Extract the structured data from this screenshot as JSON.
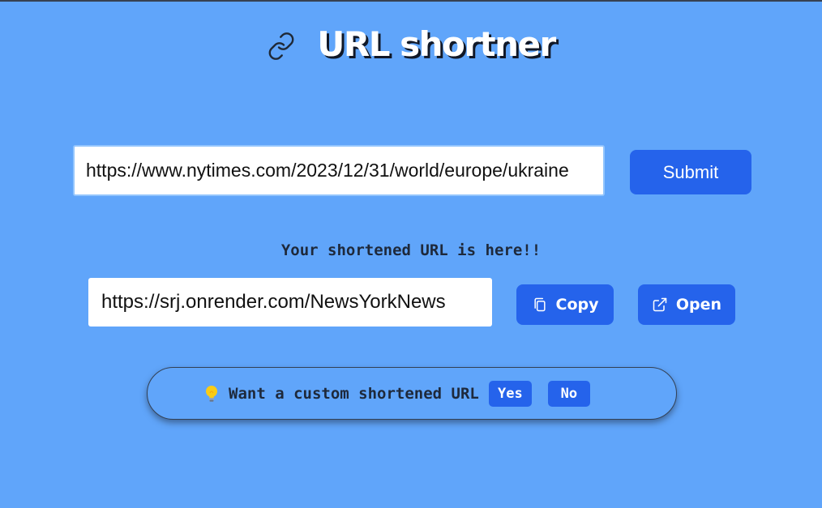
{
  "header": {
    "icon": "link-icon",
    "title": "URL shortner"
  },
  "form": {
    "url_value": "https://www.nytimes.com/2023/12/31/world/europe/ukraine",
    "submit_label": "Submit"
  },
  "result": {
    "label": "Your shortened URL is here!!",
    "short_url": "https://srj.onrender.com/NewsYorkNews",
    "copy_label": "Copy",
    "copy_icon": "copy-icon",
    "open_label": "Open",
    "open_icon": "external-link-icon"
  },
  "custom": {
    "icon": "lightbulb-icon",
    "prompt": "Want a custom shortened URL",
    "yes_label": "Yes",
    "no_label": "No"
  },
  "colors": {
    "background": "#60a5fa",
    "accent": "#2563eb",
    "text_dark": "#1e293b"
  }
}
